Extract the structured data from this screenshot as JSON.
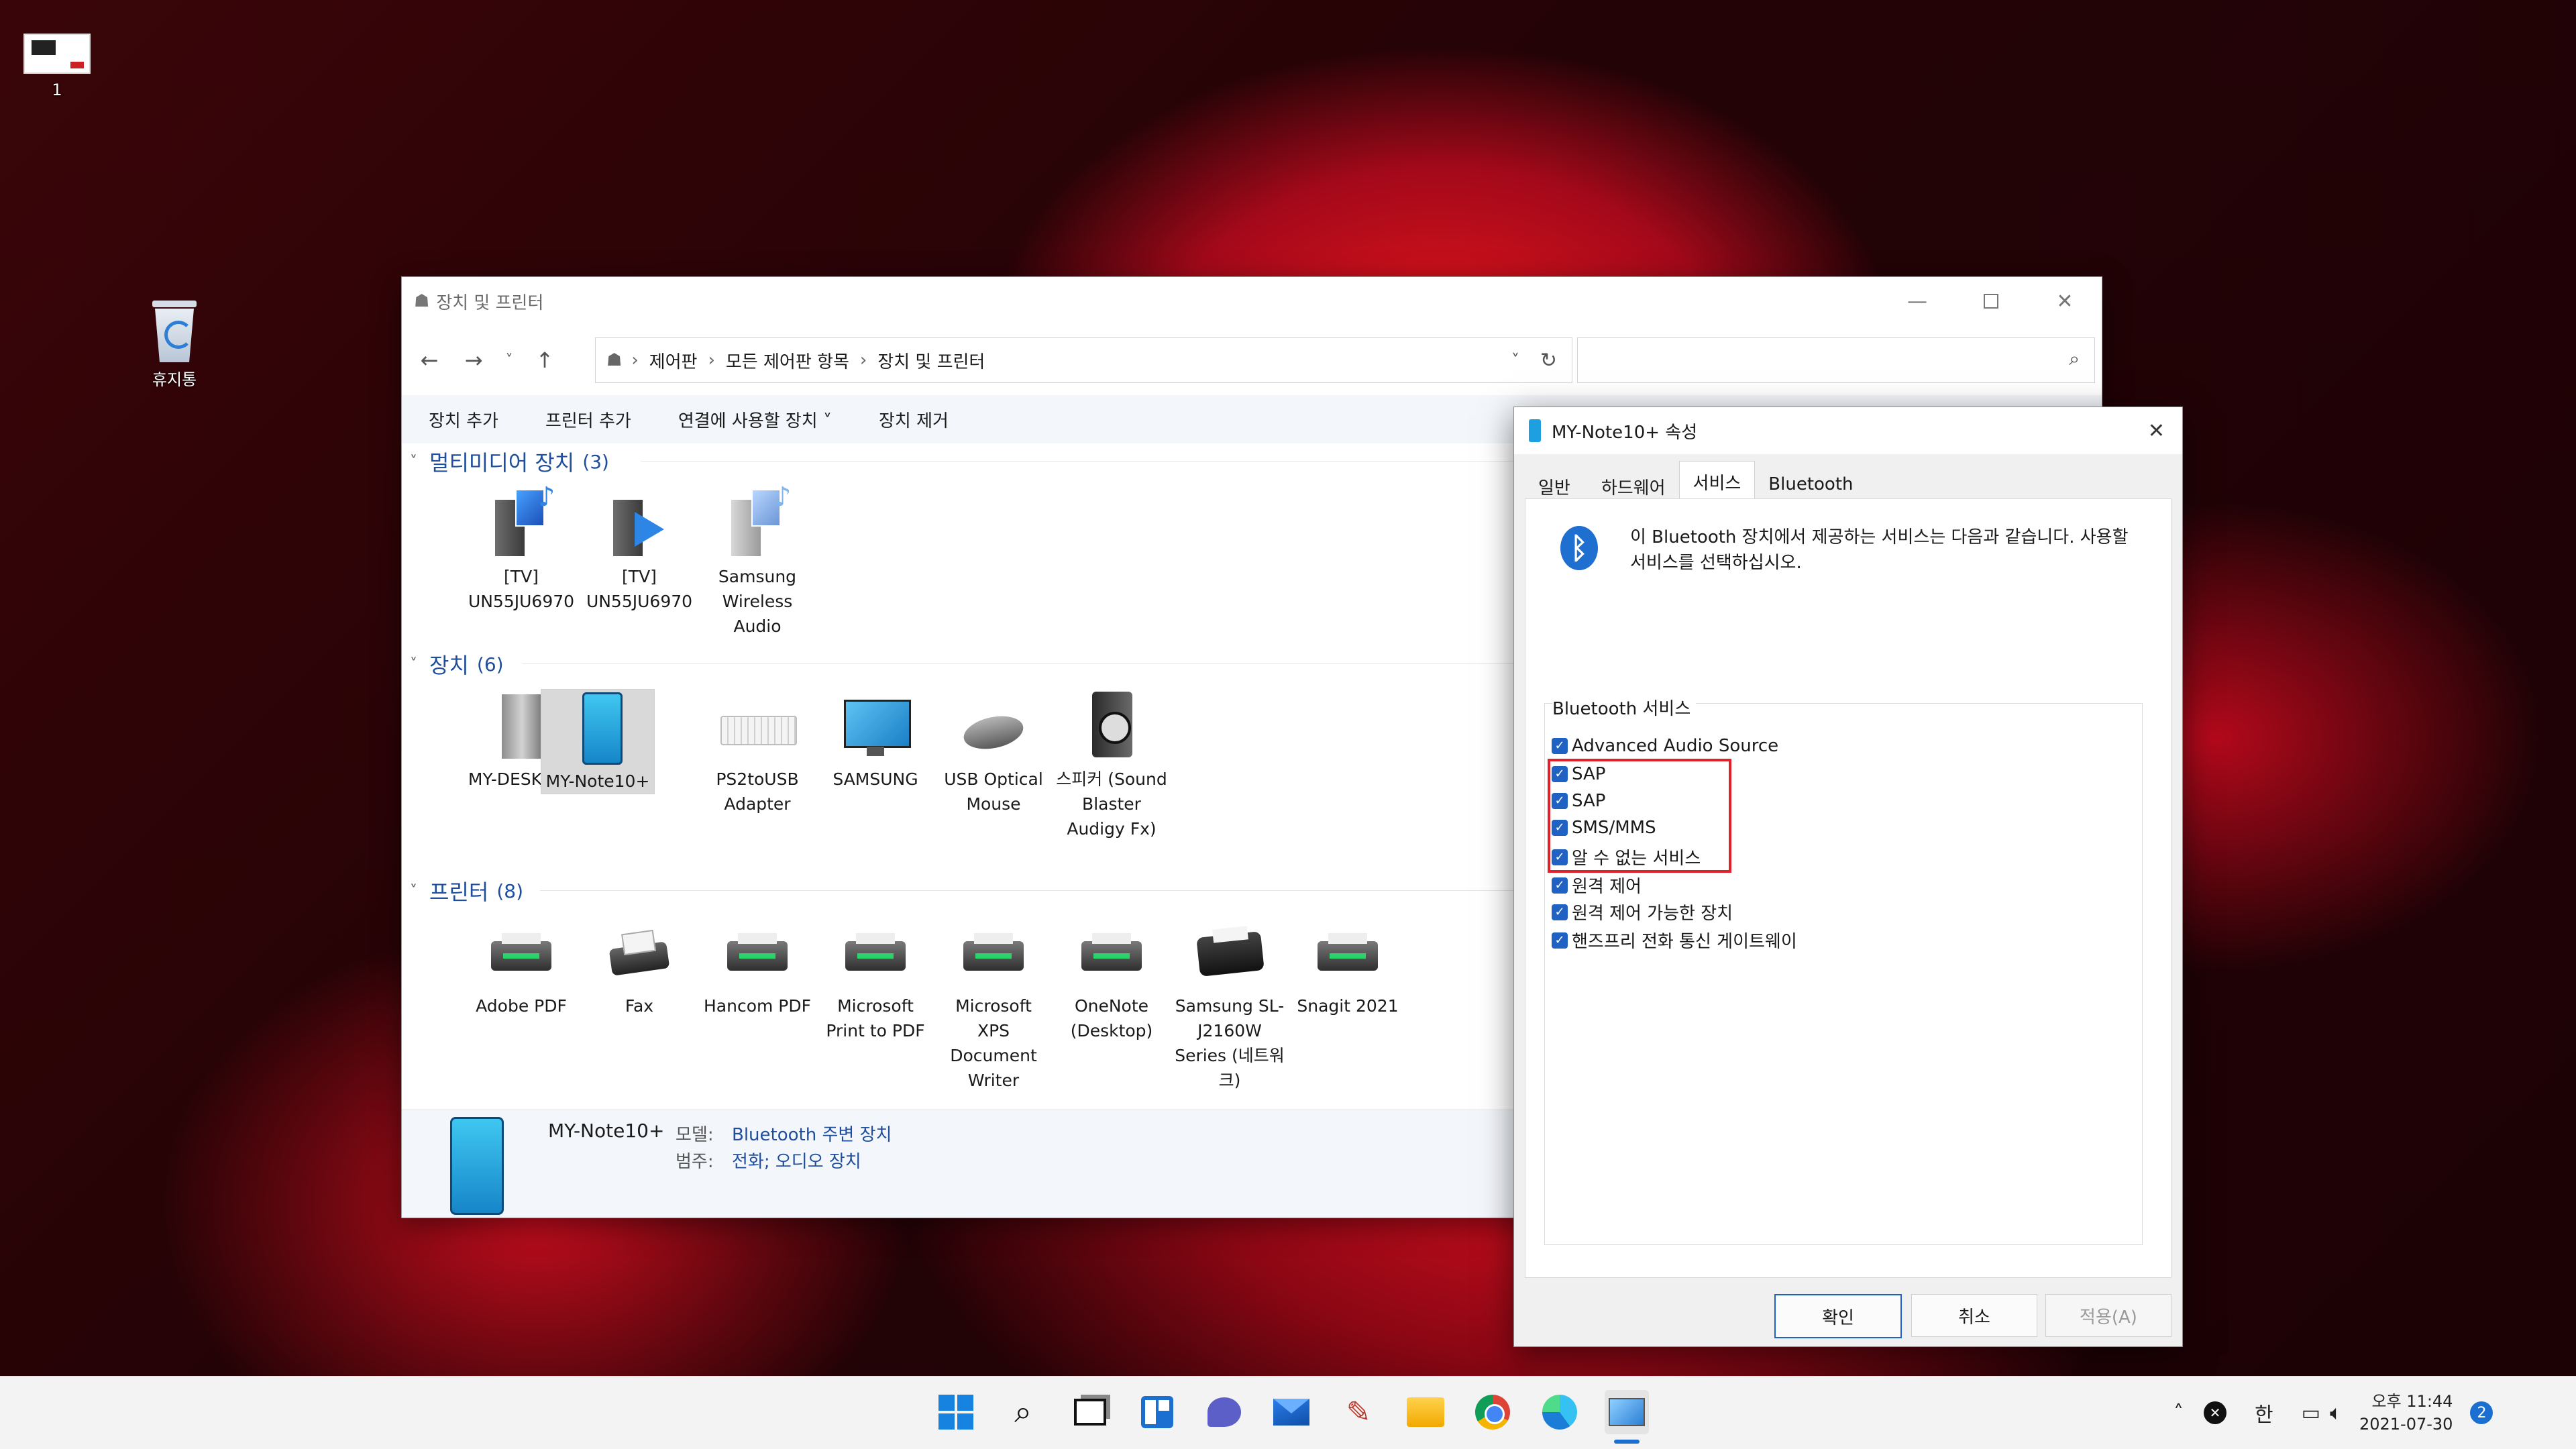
{
  "desktop": {
    "icon1_label": "1",
    "recycle_label": "휴지통"
  },
  "explorer": {
    "title": "장치 및 프린터",
    "breadcrumb": [
      "제어판",
      "모든 제어판 항목",
      "장치 및 프린터"
    ],
    "search_placeholder": "",
    "toolbar": [
      "장치 추가",
      "프린터 추가",
      "연결에 사용할 장치 ˅",
      "장치 제거"
    ],
    "groups": {
      "multimedia": {
        "title": "멀티미디어 장치",
        "count": "(3)",
        "items": [
          "[TV] UN55JU6970",
          "[TV] UN55JU6970",
          "Samsung Wireless Audio"
        ]
      },
      "devices": {
        "title": "장치",
        "count": "(6)",
        "items": [
          "MY-DESKTOP",
          "MY-Note10+",
          "PS2toUSB Adapter",
          "SAMSUNG",
          "USB Optical Mouse",
          "스피커 (Sound Blaster Audigy Fx)"
        ]
      },
      "printers": {
        "title": "프린터",
        "count": "(8)",
        "items": [
          "Adobe PDF",
          "Fax",
          "Hancom PDF",
          "Microsoft Print to PDF",
          "Microsoft XPS Document Writer",
          "OneNote (Desktop)",
          "Samsung SL-J2160W Series (네트워크)",
          "Snagit 2021"
        ]
      }
    },
    "details": {
      "name": "MY-Note10+",
      "model_label": "모델:",
      "model_value": "Bluetooth 주변 장치",
      "category_label": "범주:",
      "category_value": "전화; 오디오 장치"
    }
  },
  "dialog": {
    "title": "MY-Note10+ 속성",
    "tabs": [
      "일반",
      "하드웨어",
      "서비스",
      "Bluetooth"
    ],
    "description": "이 Bluetooth 장치에서 제공하는 서비스는 다음과 같습니다. 사용할 서비스를 선택하십시오.",
    "group_label": "Bluetooth 서비스",
    "services": [
      "Advanced Audio Source",
      "SAP",
      "SAP",
      "SMS/MMS",
      "알 수 없는 서비스",
      "원격 제어",
      "원격 제어 가능한 장치",
      "핸즈프리 전화 통신 게이트웨이"
    ],
    "ok": "확인",
    "cancel": "취소",
    "apply": "적용(A)",
    "highlight_color": "#e0202a"
  },
  "taskbar": {
    "time": "오후 11:44",
    "date": "2021-07-30",
    "ime": "한",
    "notification_count": "2"
  }
}
